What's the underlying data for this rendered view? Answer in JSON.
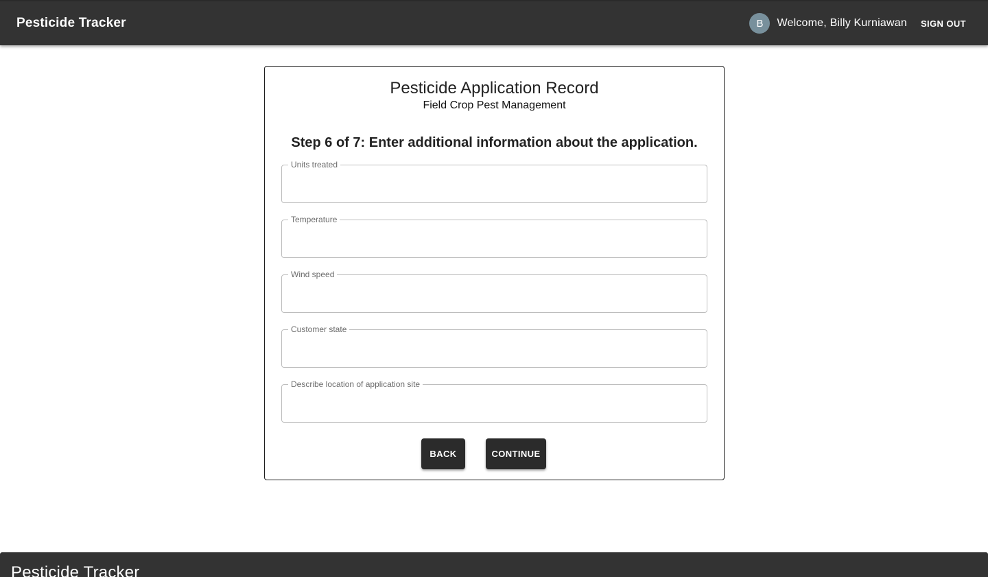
{
  "app": {
    "title": "Pesticide Tracker"
  },
  "header": {
    "avatar_initial": "B",
    "welcome_text": "Welcome, Billy Kurniawan",
    "sign_out_label": "SIGN OUT"
  },
  "form": {
    "title": "Pesticide Application Record",
    "subtitle": "Field Crop Pest Management",
    "step_heading": "Step 6 of 7: Enter additional information about the application.",
    "fields": [
      {
        "label": "Units treated",
        "value": ""
      },
      {
        "label": "Temperature",
        "value": ""
      },
      {
        "label": "Wind speed",
        "value": ""
      },
      {
        "label": "Customer state",
        "value": ""
      },
      {
        "label": "Describe location of application site",
        "value": ""
      }
    ],
    "back_label": "BACK",
    "continue_label": "CONTINUE"
  },
  "footer": {
    "title": "Pesticide Tracker"
  },
  "colors": {
    "appbar": "#333333",
    "button": "#2b2b2b",
    "avatar": "#78909c"
  }
}
